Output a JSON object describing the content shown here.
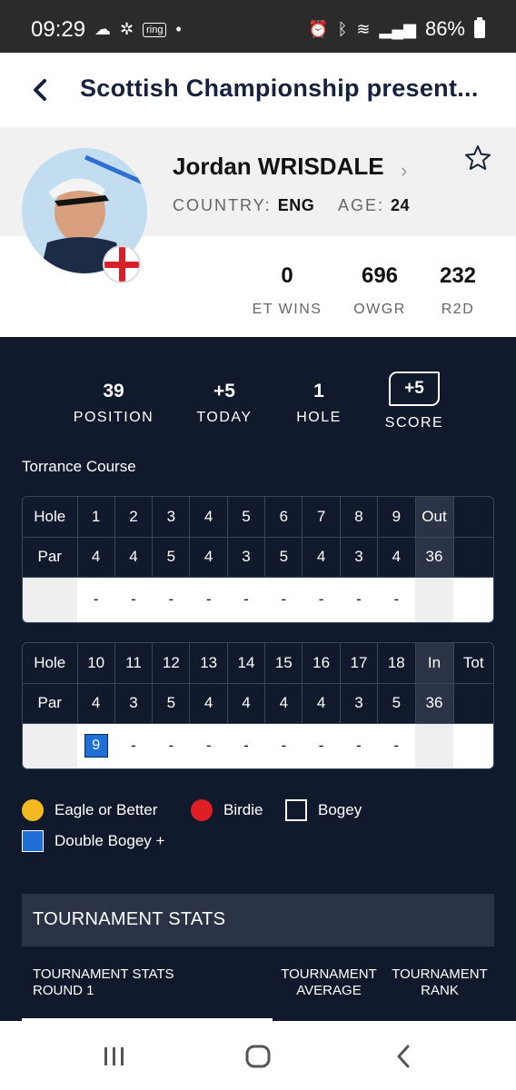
{
  "status_bar": {
    "time": "09:29",
    "ring_label": "ring",
    "battery": "86%"
  },
  "header": {
    "title": "Scottish Championship present..."
  },
  "player": {
    "name": "Jordan WRISDALE",
    "country_label": "COUNTRY:",
    "country_value": "ENG",
    "age_label": "AGE:",
    "age_value": "24",
    "stats": [
      {
        "value": "0",
        "label": "ET WINS"
      },
      {
        "value": "696",
        "label": "OWGR"
      },
      {
        "value": "232",
        "label": "R2D"
      }
    ]
  },
  "summary": {
    "position": {
      "value": "39",
      "label": "POSITION"
    },
    "today": {
      "value": "+5",
      "label": "TODAY"
    },
    "hole": {
      "value": "1",
      "label": "HOLE"
    },
    "score": {
      "value": "+5",
      "label": "SCORE"
    }
  },
  "course": "Torrance Course",
  "front_nine": {
    "hole_label": "Hole",
    "par_label": "Par",
    "holes": [
      "1",
      "2",
      "3",
      "4",
      "5",
      "6",
      "7",
      "8",
      "9"
    ],
    "pars": [
      "4",
      "4",
      "5",
      "4",
      "3",
      "5",
      "4",
      "3",
      "4"
    ],
    "total_label": "Out",
    "total_par": "36",
    "scores": [
      "-",
      "-",
      "-",
      "-",
      "-",
      "-",
      "-",
      "-",
      "-"
    ]
  },
  "back_nine": {
    "hole_label": "Hole",
    "par_label": "Par",
    "holes": [
      "10",
      "11",
      "12",
      "13",
      "14",
      "15",
      "16",
      "17",
      "18"
    ],
    "pars": [
      "4",
      "3",
      "5",
      "4",
      "4",
      "4",
      "4",
      "3",
      "5"
    ],
    "total_label": "In",
    "grand_label": "Tot",
    "total_par": "36",
    "scores": [
      "9",
      "-",
      "-",
      "-",
      "-",
      "-",
      "-",
      "-",
      "-"
    ]
  },
  "legend": {
    "eagle": "Eagle or Better",
    "birdie": "Birdie",
    "bogey": "Bogey",
    "double": "Double Bogey +",
    "colors": {
      "eagle": "#f5b921",
      "birdie": "#e01e26",
      "bogey": "#101a2c",
      "double": "#1f6fd6"
    }
  },
  "tournament_stats": {
    "title": "TOURNAMENT STATS",
    "col1_line1": "TOURNAMENT STATS",
    "col1_line2": "ROUND 1",
    "col2_line1": "TOURNAMENT",
    "col2_line2": "AVERAGE",
    "col3_line1": "TOURNAMENT",
    "col3_line2": "RANK"
  }
}
